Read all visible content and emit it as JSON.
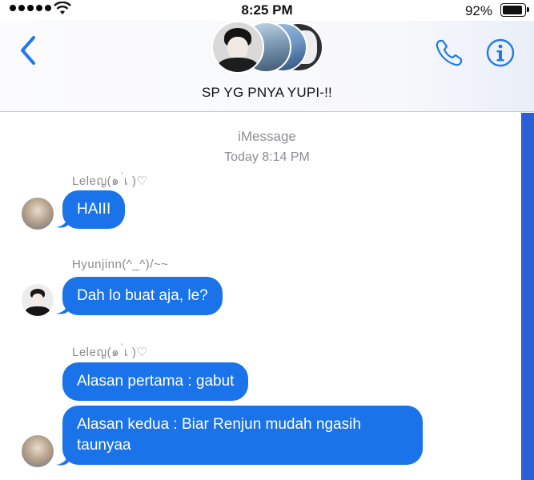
{
  "status": {
    "time": "8:25 PM",
    "battery": "92%",
    "battery_level": 0.92
  },
  "header": {
    "title": "SP YG PNYA YUPI-!!"
  },
  "thread": {
    "service": "iMessage",
    "timestamp": "Today 8:14 PM"
  },
  "messages": [
    {
      "sender": "Leleญ(๑ ่เ )♡",
      "text": "HAIII"
    },
    {
      "sender": "Hyunjinn(^_^)/~~",
      "text": "Dah lo buat aja, le?"
    },
    {
      "sender": "Leleญ(๑ ่เ )♡",
      "text": "Alasan pertama : gabut"
    },
    {
      "text": "Alasan kedua : Biar Renjun mudah ngasih",
      "text2": "taunyaa"
    }
  ],
  "colors": {
    "accent": "#1a73e8",
    "nav_blue": "#1f7aea"
  },
  "icons": {
    "back": "chevron-left-icon",
    "call": "phone-icon",
    "details": "info-icon"
  }
}
